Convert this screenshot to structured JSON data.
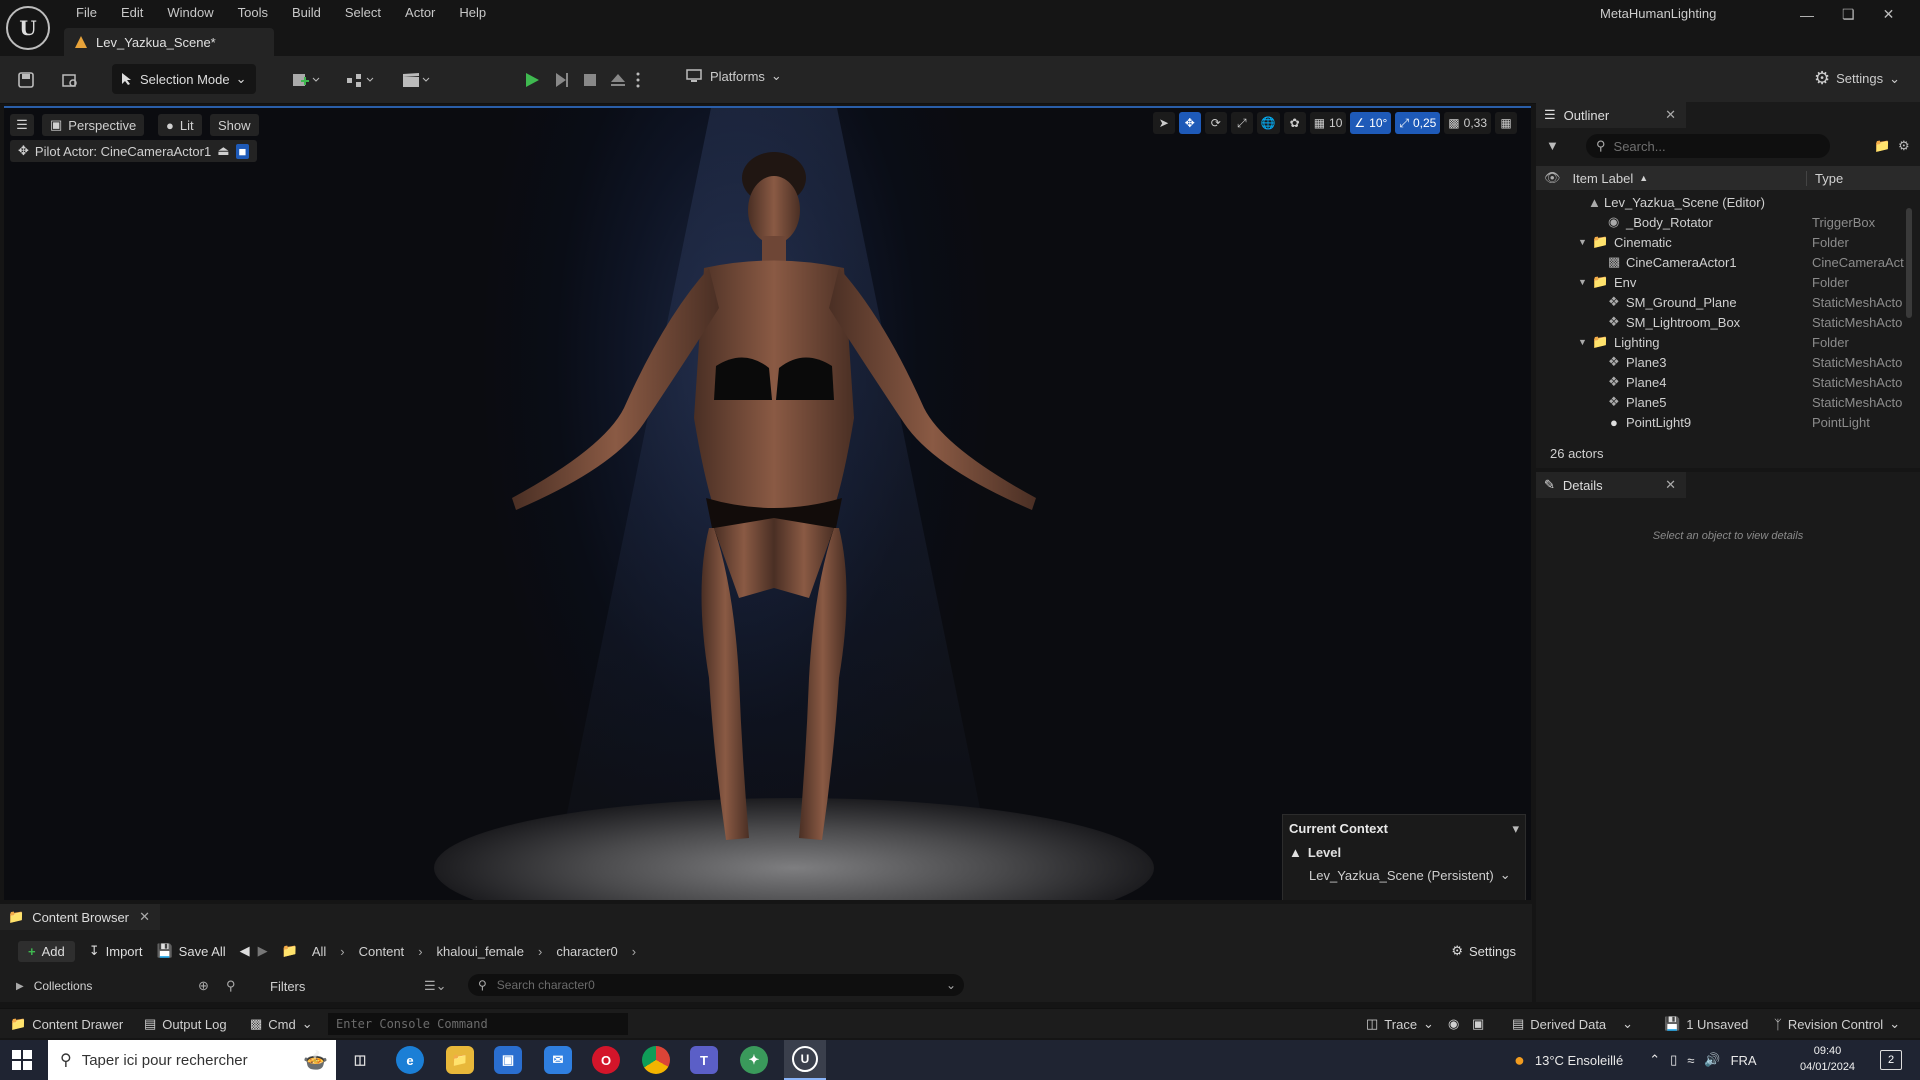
{
  "app": {
    "project_name": "MetaHumanLighting",
    "document_tab": "Lev_Yazkua_Scene*"
  },
  "menu": [
    "File",
    "Edit",
    "Window",
    "Tools",
    "Build",
    "Select",
    "Actor",
    "Help"
  ],
  "toolbar": {
    "selection_mode": "Selection Mode",
    "platforms": "Platforms",
    "settings": "Settings"
  },
  "viewport": {
    "perspective": "Perspective",
    "lit": "Lit",
    "show": "Show",
    "pilot_actor": "Pilot Actor: CineCameraActor1",
    "grid_snap": "10",
    "rotation_snap": "10°",
    "scale_snap": "0,25",
    "camera_speed": "0,33"
  },
  "current_context": {
    "title": "Current Context",
    "level_label": "Level",
    "level_value": "Lev_Yazkua_Scene (Persistent)"
  },
  "outliner": {
    "tab": "Outliner",
    "search_placeholder": "Search...",
    "col_label": "Item Label",
    "col_type": "Type",
    "rows": [
      {
        "label": "Lev_Yazkua_Scene (Editor)",
        "type": ""
      },
      {
        "label": "_Body_Rotator",
        "type": "TriggerBox"
      },
      {
        "label": "Cinematic",
        "type": "Folder"
      },
      {
        "label": "CineCameraActor1",
        "type": "CineCameraAct"
      },
      {
        "label": "Env",
        "type": "Folder"
      },
      {
        "label": "SM_Ground_Plane",
        "type": "StaticMeshActo"
      },
      {
        "label": "SM_Lightroom_Box",
        "type": "StaticMeshActo"
      },
      {
        "label": "Lighting",
        "type": "Folder"
      },
      {
        "label": "Plane3",
        "type": "StaticMeshActo"
      },
      {
        "label": "Plane4",
        "type": "StaticMeshActo"
      },
      {
        "label": "Plane5",
        "type": "StaticMeshActo"
      },
      {
        "label": "PointLight9",
        "type": "PointLight"
      }
    ],
    "actor_count": "26 actors"
  },
  "details": {
    "tab": "Details",
    "empty_message": "Select an object to view details"
  },
  "content_browser": {
    "tab": "Content Browser",
    "add": "Add",
    "import": "Import",
    "save_all": "Save All",
    "breadcrumbs": [
      "All",
      "Content",
      "khaloui_female",
      "character0"
    ],
    "settings": "Settings",
    "collections": "Collections",
    "filters": "Filters",
    "search_placeholder": "Search character0"
  },
  "statusbar": {
    "content_drawer": "Content Drawer",
    "output_log": "Output Log",
    "cmd": "Cmd",
    "console_placeholder": "Enter Console Command",
    "trace": "Trace",
    "derived_data": "Derived Data",
    "unsaved": "1 Unsaved",
    "revision_control": "Revision Control"
  },
  "taskbar": {
    "search_placeholder": "Taper ici pour rechercher",
    "weather": "13°C  Ensoleillé",
    "language": "FRA",
    "time": "09:40",
    "date": "04/01/2024",
    "notification_count": "2"
  },
  "colors": {
    "accent_blue": "#1e5ab8",
    "play_green": "#3fb950",
    "warning_orange": "#e8a33a"
  }
}
